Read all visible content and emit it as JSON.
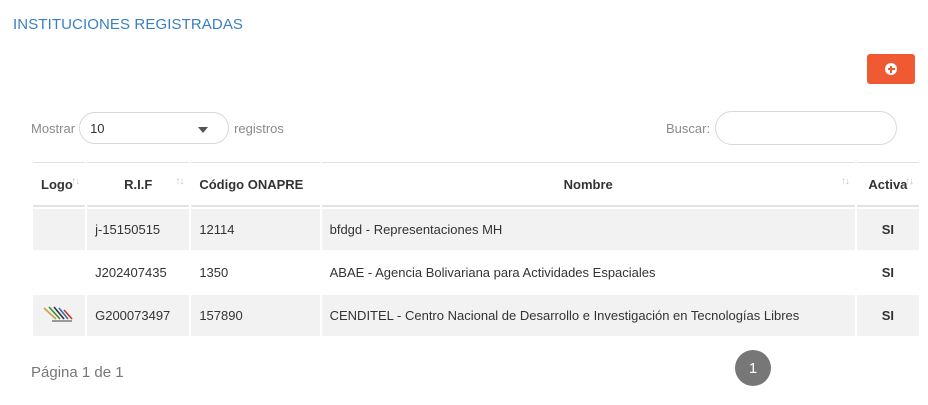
{
  "page": {
    "title": "INSTITUCIONES REGISTRADAS"
  },
  "add_button": {
    "icon": "plus-circle-icon"
  },
  "length": {
    "prefix": "Mostrar",
    "value": "10",
    "suffix": "registros"
  },
  "search": {
    "label": "Buscar:",
    "value": "",
    "placeholder": ""
  },
  "table": {
    "columns": [
      "Logo",
      "R.I.F",
      "Código ONAPRE",
      "Nombre",
      "Activa"
    ],
    "rows": [
      {
        "logo": "",
        "rif": "j-15150515",
        "onapre": "12114",
        "nombre": "bfdgd - Representaciones MH",
        "activa": "SI"
      },
      {
        "logo": "",
        "rif": "J202407435",
        "onapre": "1350",
        "nombre": "ABAE - Agencia Bolivariana para Actividades Espaciales",
        "activa": "SI"
      },
      {
        "logo": "cenditel-logo",
        "rif": "G200073497",
        "onapre": "157890",
        "nombre": "CENDITEL - Centro Nacional de Desarrollo e Investigación en Tecnologías Libres",
        "activa": "SI"
      }
    ]
  },
  "pagination": {
    "info": "Página 1 de 1",
    "current": "1"
  },
  "colors": {
    "accent": "#f05a33",
    "title": "#3a7fc1",
    "active": "#2db52d",
    "rif": "#e8593a"
  }
}
